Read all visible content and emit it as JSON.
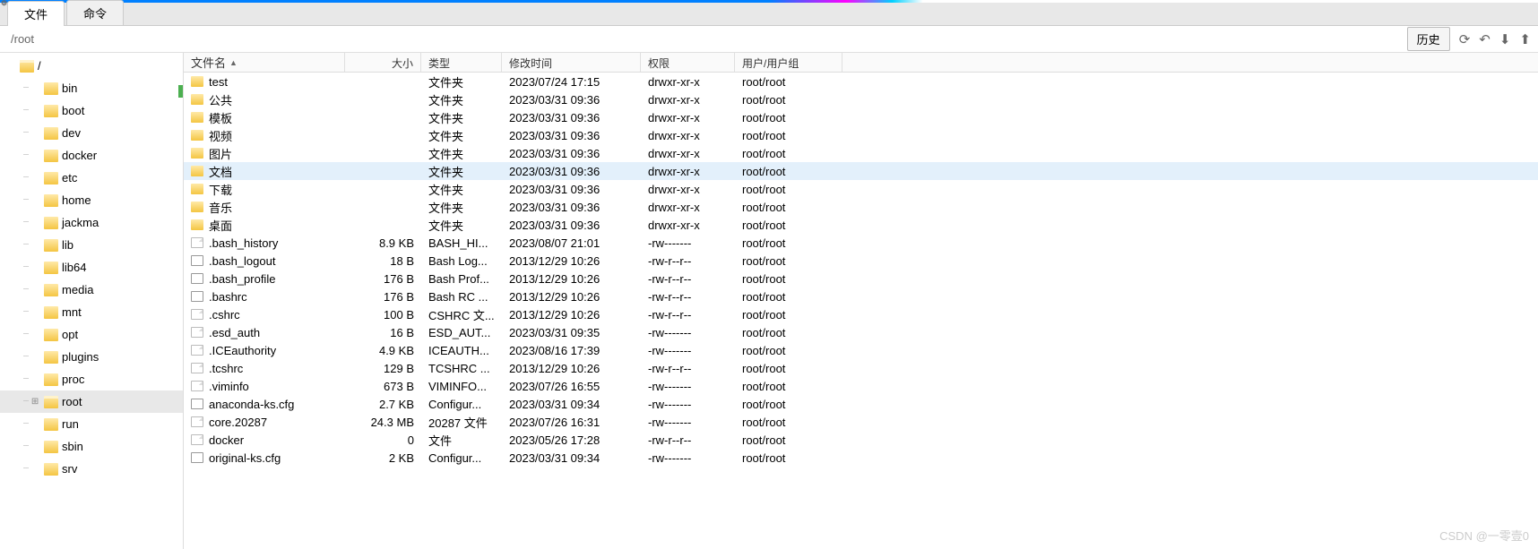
{
  "tabs": {
    "file": "文件",
    "cmd": "命令"
  },
  "path": "/root",
  "history_btn": "历史",
  "tree": [
    {
      "label": "/",
      "level": 0,
      "icon": "folder-open",
      "exp": ""
    },
    {
      "label": "bin",
      "level": 1,
      "icon": "folder"
    },
    {
      "label": "boot",
      "level": 1,
      "icon": "folder"
    },
    {
      "label": "dev",
      "level": 1,
      "icon": "folder"
    },
    {
      "label": "docker",
      "level": 1,
      "icon": "folder"
    },
    {
      "label": "etc",
      "level": 1,
      "icon": "folder"
    },
    {
      "label": "home",
      "level": 1,
      "icon": "folder"
    },
    {
      "label": "jackma",
      "level": 1,
      "icon": "folder"
    },
    {
      "label": "lib",
      "level": 1,
      "icon": "folder"
    },
    {
      "label": "lib64",
      "level": 1,
      "icon": "folder"
    },
    {
      "label": "media",
      "level": 1,
      "icon": "folder"
    },
    {
      "label": "mnt",
      "level": 1,
      "icon": "folder"
    },
    {
      "label": "opt",
      "level": 1,
      "icon": "folder"
    },
    {
      "label": "plugins",
      "level": 1,
      "icon": "folder"
    },
    {
      "label": "proc",
      "level": 1,
      "icon": "folder"
    },
    {
      "label": "root",
      "level": 1,
      "icon": "folder-open",
      "exp": "⊞",
      "selected": true
    },
    {
      "label": "run",
      "level": 1,
      "icon": "folder"
    },
    {
      "label": "sbin",
      "level": 1,
      "icon": "folder"
    },
    {
      "label": "srv",
      "level": 1,
      "icon": "folder"
    }
  ],
  "columns": {
    "name": "文件名",
    "size": "大小",
    "type": "类型",
    "date": "修改时间",
    "perm": "权限",
    "owner": "用户/用户组"
  },
  "rows": [
    {
      "icon": "folder",
      "name": "test",
      "size": "",
      "type": "文件夹",
      "date": "2023/07/24 17:15",
      "perm": "drwxr-xr-x",
      "owner": "root/root"
    },
    {
      "icon": "folder",
      "name": "公共",
      "size": "",
      "type": "文件夹",
      "date": "2023/03/31 09:36",
      "perm": "drwxr-xr-x",
      "owner": "root/root"
    },
    {
      "icon": "folder",
      "name": "模板",
      "size": "",
      "type": "文件夹",
      "date": "2023/03/31 09:36",
      "perm": "drwxr-xr-x",
      "owner": "root/root"
    },
    {
      "icon": "folder",
      "name": "视频",
      "size": "",
      "type": "文件夹",
      "date": "2023/03/31 09:36",
      "perm": "drwxr-xr-x",
      "owner": "root/root"
    },
    {
      "icon": "folder",
      "name": "图片",
      "size": "",
      "type": "文件夹",
      "date": "2023/03/31 09:36",
      "perm": "drwxr-xr-x",
      "owner": "root/root"
    },
    {
      "icon": "folder",
      "name": "文档",
      "size": "",
      "type": "文件夹",
      "date": "2023/03/31 09:36",
      "perm": "drwxr-xr-x",
      "owner": "root/root",
      "selected": true
    },
    {
      "icon": "folder",
      "name": "下载",
      "size": "",
      "type": "文件夹",
      "date": "2023/03/31 09:36",
      "perm": "drwxr-xr-x",
      "owner": "root/root"
    },
    {
      "icon": "folder",
      "name": "音乐",
      "size": "",
      "type": "文件夹",
      "date": "2023/03/31 09:36",
      "perm": "drwxr-xr-x",
      "owner": "root/root"
    },
    {
      "icon": "folder",
      "name": "桌面",
      "size": "",
      "type": "文件夹",
      "date": "2023/03/31 09:36",
      "perm": "drwxr-xr-x",
      "owner": "root/root"
    },
    {
      "icon": "file",
      "name": ".bash_history",
      "size": "8.9 KB",
      "type": "BASH_HI...",
      "date": "2023/08/07 21:01",
      "perm": "-rw-------",
      "owner": "root/root"
    },
    {
      "icon": "cfg",
      "name": ".bash_logout",
      "size": "18 B",
      "type": "Bash Log...",
      "date": "2013/12/29 10:26",
      "perm": "-rw-r--r--",
      "owner": "root/root"
    },
    {
      "icon": "cfg",
      "name": ".bash_profile",
      "size": "176 B",
      "type": "Bash Prof...",
      "date": "2013/12/29 10:26",
      "perm": "-rw-r--r--",
      "owner": "root/root"
    },
    {
      "icon": "cfg",
      "name": ".bashrc",
      "size": "176 B",
      "type": "Bash RC ...",
      "date": "2013/12/29 10:26",
      "perm": "-rw-r--r--",
      "owner": "root/root"
    },
    {
      "icon": "file",
      "name": ".cshrc",
      "size": "100 B",
      "type": "CSHRC 文...",
      "date": "2013/12/29 10:26",
      "perm": "-rw-r--r--",
      "owner": "root/root"
    },
    {
      "icon": "file",
      "name": ".esd_auth",
      "size": "16 B",
      "type": "ESD_AUT...",
      "date": "2023/03/31 09:35",
      "perm": "-rw-------",
      "owner": "root/root"
    },
    {
      "icon": "file",
      "name": ".ICEauthority",
      "size": "4.9 KB",
      "type": "ICEAUTH...",
      "date": "2023/08/16 17:39",
      "perm": "-rw-------",
      "owner": "root/root"
    },
    {
      "icon": "file",
      "name": ".tcshrc",
      "size": "129 B",
      "type": "TCSHRC ...",
      "date": "2013/12/29 10:26",
      "perm": "-rw-r--r--",
      "owner": "root/root"
    },
    {
      "icon": "file",
      "name": ".viminfo",
      "size": "673 B",
      "type": "VIMINFO...",
      "date": "2023/07/26 16:55",
      "perm": "-rw-------",
      "owner": "root/root"
    },
    {
      "icon": "cfg",
      "name": "anaconda-ks.cfg",
      "size": "2.7 KB",
      "type": "Configur...",
      "date": "2023/03/31 09:34",
      "perm": "-rw-------",
      "owner": "root/root"
    },
    {
      "icon": "file",
      "name": "core.20287",
      "size": "24.3 MB",
      "type": "20287 文件",
      "date": "2023/07/26 16:31",
      "perm": "-rw-------",
      "owner": "root/root"
    },
    {
      "icon": "file",
      "name": "docker",
      "size": "0",
      "type": "文件",
      "date": "2023/05/26 17:28",
      "perm": "-rw-r--r--",
      "owner": "root/root"
    },
    {
      "icon": "cfg",
      "name": "original-ks.cfg",
      "size": "2 KB",
      "type": "Configur...",
      "date": "2023/03/31 09:34",
      "perm": "-rw-------",
      "owner": "root/root"
    }
  ],
  "watermark": "CSDN @一零壹0"
}
